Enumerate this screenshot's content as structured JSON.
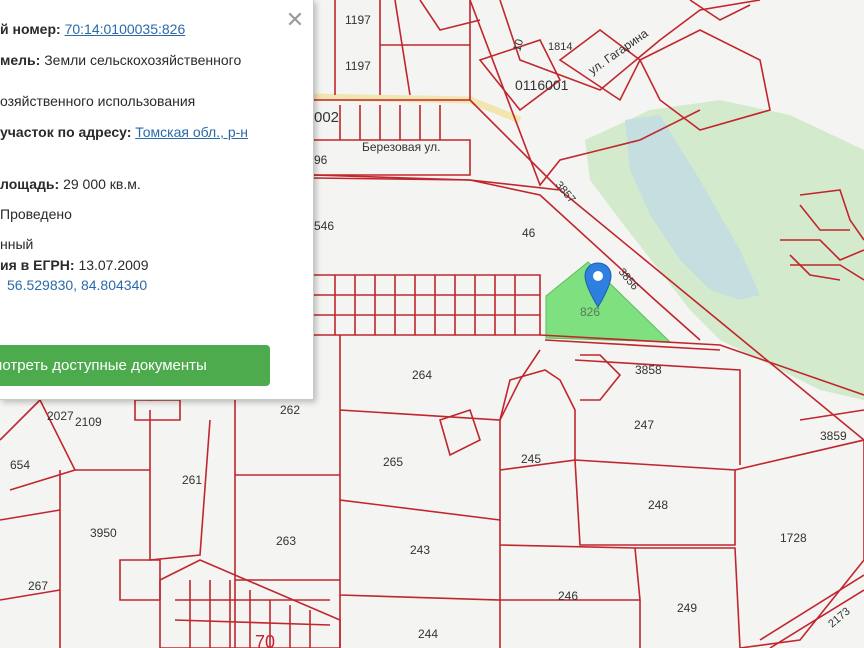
{
  "info_panel": {
    "cadastral_number_label": "й номер:",
    "cadastral_number_value": "70:14:0100035:826",
    "land_category_label": "мель:",
    "land_category_value": "Земли сельскохозяйственного",
    "land_use_value": "озяйственного использования",
    "address_label": "участок по адресу:",
    "address_value": "Томская обл., р-н",
    "area_label": "лощадь:",
    "area_value": "29 000 кв.м.",
    "survey_value": "Проведено",
    "status_value": "нный",
    "egrn_label": "ия в ЕГРН:",
    "egrn_value": "13.07.2009",
    "coordinates_value": "56.529830, 84.804340",
    "documents_button": "мотреть доступные документы",
    "close_symbol": "✕"
  },
  "map": {
    "selected_plot": "826",
    "streets": {
      "berezovaya": "Березовая ул.",
      "gagarina": "ул. Гагарина"
    },
    "plot_numbers": {
      "p1197a": "1197",
      "p1197b": "1197",
      "p0116001": "0116001",
      "p1814": "1814",
      "p10": "10",
      "p002": "002",
      "p96": "96",
      "p546": "546",
      "p46": "46",
      "p3857": "3857",
      "p3856": "3856",
      "p264": "264",
      "p3858": "3858",
      "p262": "262",
      "p2027": "2027",
      "p2109": "2109",
      "p247": "247",
      "p3859": "3859",
      "p654": "654",
      "p261": "261",
      "p265": "265",
      "p245": "245",
      "p248": "248",
      "p3950": "3950",
      "p263": "263",
      "p243": "243",
      "p1728": "1728",
      "p267": "267",
      "p246": "246",
      "p249": "249",
      "p244": "244",
      "p2173": "2173",
      "p70": "70"
    },
    "colors": {
      "boundary": "#c0262d",
      "selected_fill": "#7fe07f",
      "forest": "#cfe8c8",
      "water": "#c6dfe0",
      "marker": "#2d7fe0"
    }
  }
}
